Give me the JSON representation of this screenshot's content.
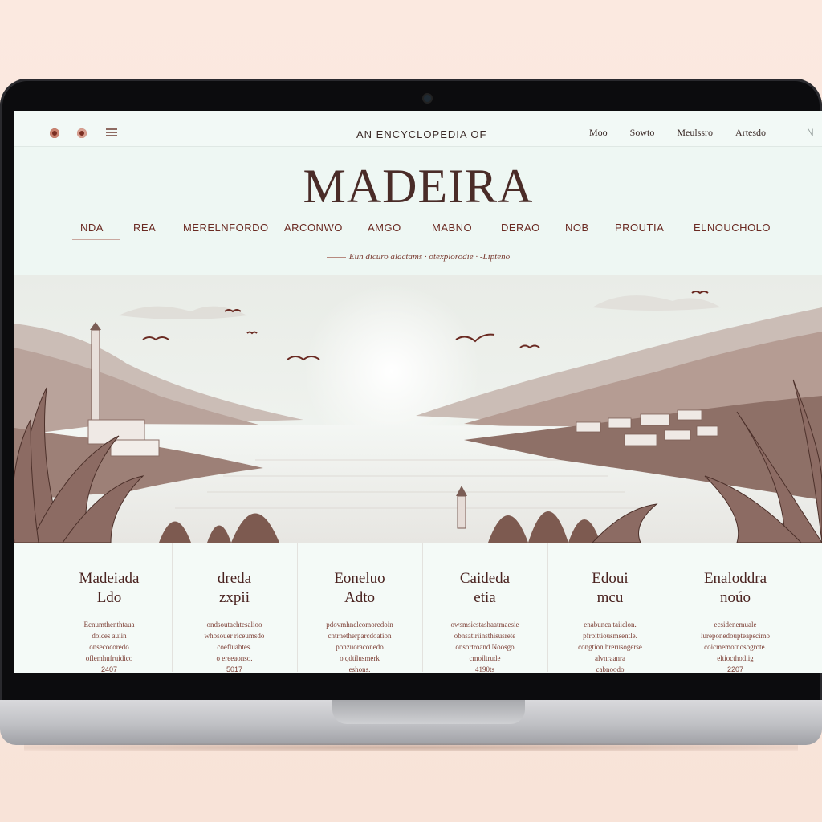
{
  "header": {
    "subtitle": "AN ENCYCLOPEDIA OF",
    "top_nav": [
      "Moo",
      "Sowto",
      "Meulssro",
      "Artesdo"
    ],
    "top_nav_extra": "N",
    "site_title": "MADEIRA"
  },
  "main_nav": [
    "NDA",
    "REA",
    "MERELNFORDO",
    "ARCONWO",
    "AMGO",
    "MABNO",
    "DERAO",
    "NOB",
    "PROUTIA",
    "ELNOUCHOLO"
  ],
  "tagline": {
    "text": "Eun dicuro alactams  ·  otexplorodie  ·  -Lipteno"
  },
  "cards": [
    {
      "title": "Madeiada\nLdo",
      "body": "Ecnumthenthtaua\ndoices auiin\nonsecocoredo\noflemhufruidico",
      "foot": "2407"
    },
    {
      "title": "dreda\nzxpii",
      "body": "ondsoutachtesalioo\nwhosouer riceumsdo\ncoefluabtes.\no ereeaonso.",
      "foot": "5017"
    },
    {
      "title": "Eoneluo\nAdto",
      "body": "pdovmhnelcomoredoin\ncntrhetherparcdoation\nponzuoraconedo\no qdtilusmerk\neshons.",
      "foot": ""
    },
    {
      "title": "Caideda\netia",
      "body": "owsmsicstashaatmaesie\nobnsatiriinsthisusrete\nonsortroand Noosgo\ncmoiltrude\n4190ts",
      "foot": ""
    },
    {
      "title": "Edoui\nmcu",
      "body": "enabunca taiiclon.\npfrbittiousmsentle.\ncongtion hrerusogerse\nalvnraanra\ncabnoodo",
      "foot": ""
    },
    {
      "title": "Enaloddra\nnoúo",
      "body": "ecsidenemuale\nlureponedoupteapscimo\ncoicmemotnosogrote.\neltiocthodiig",
      "foot": "2207"
    }
  ],
  "colors": {
    "accent": "#6a2a22",
    "title": "#4a2c28",
    "screen_bg": "#eef7f3",
    "page_bg": "#fbe9e0"
  }
}
